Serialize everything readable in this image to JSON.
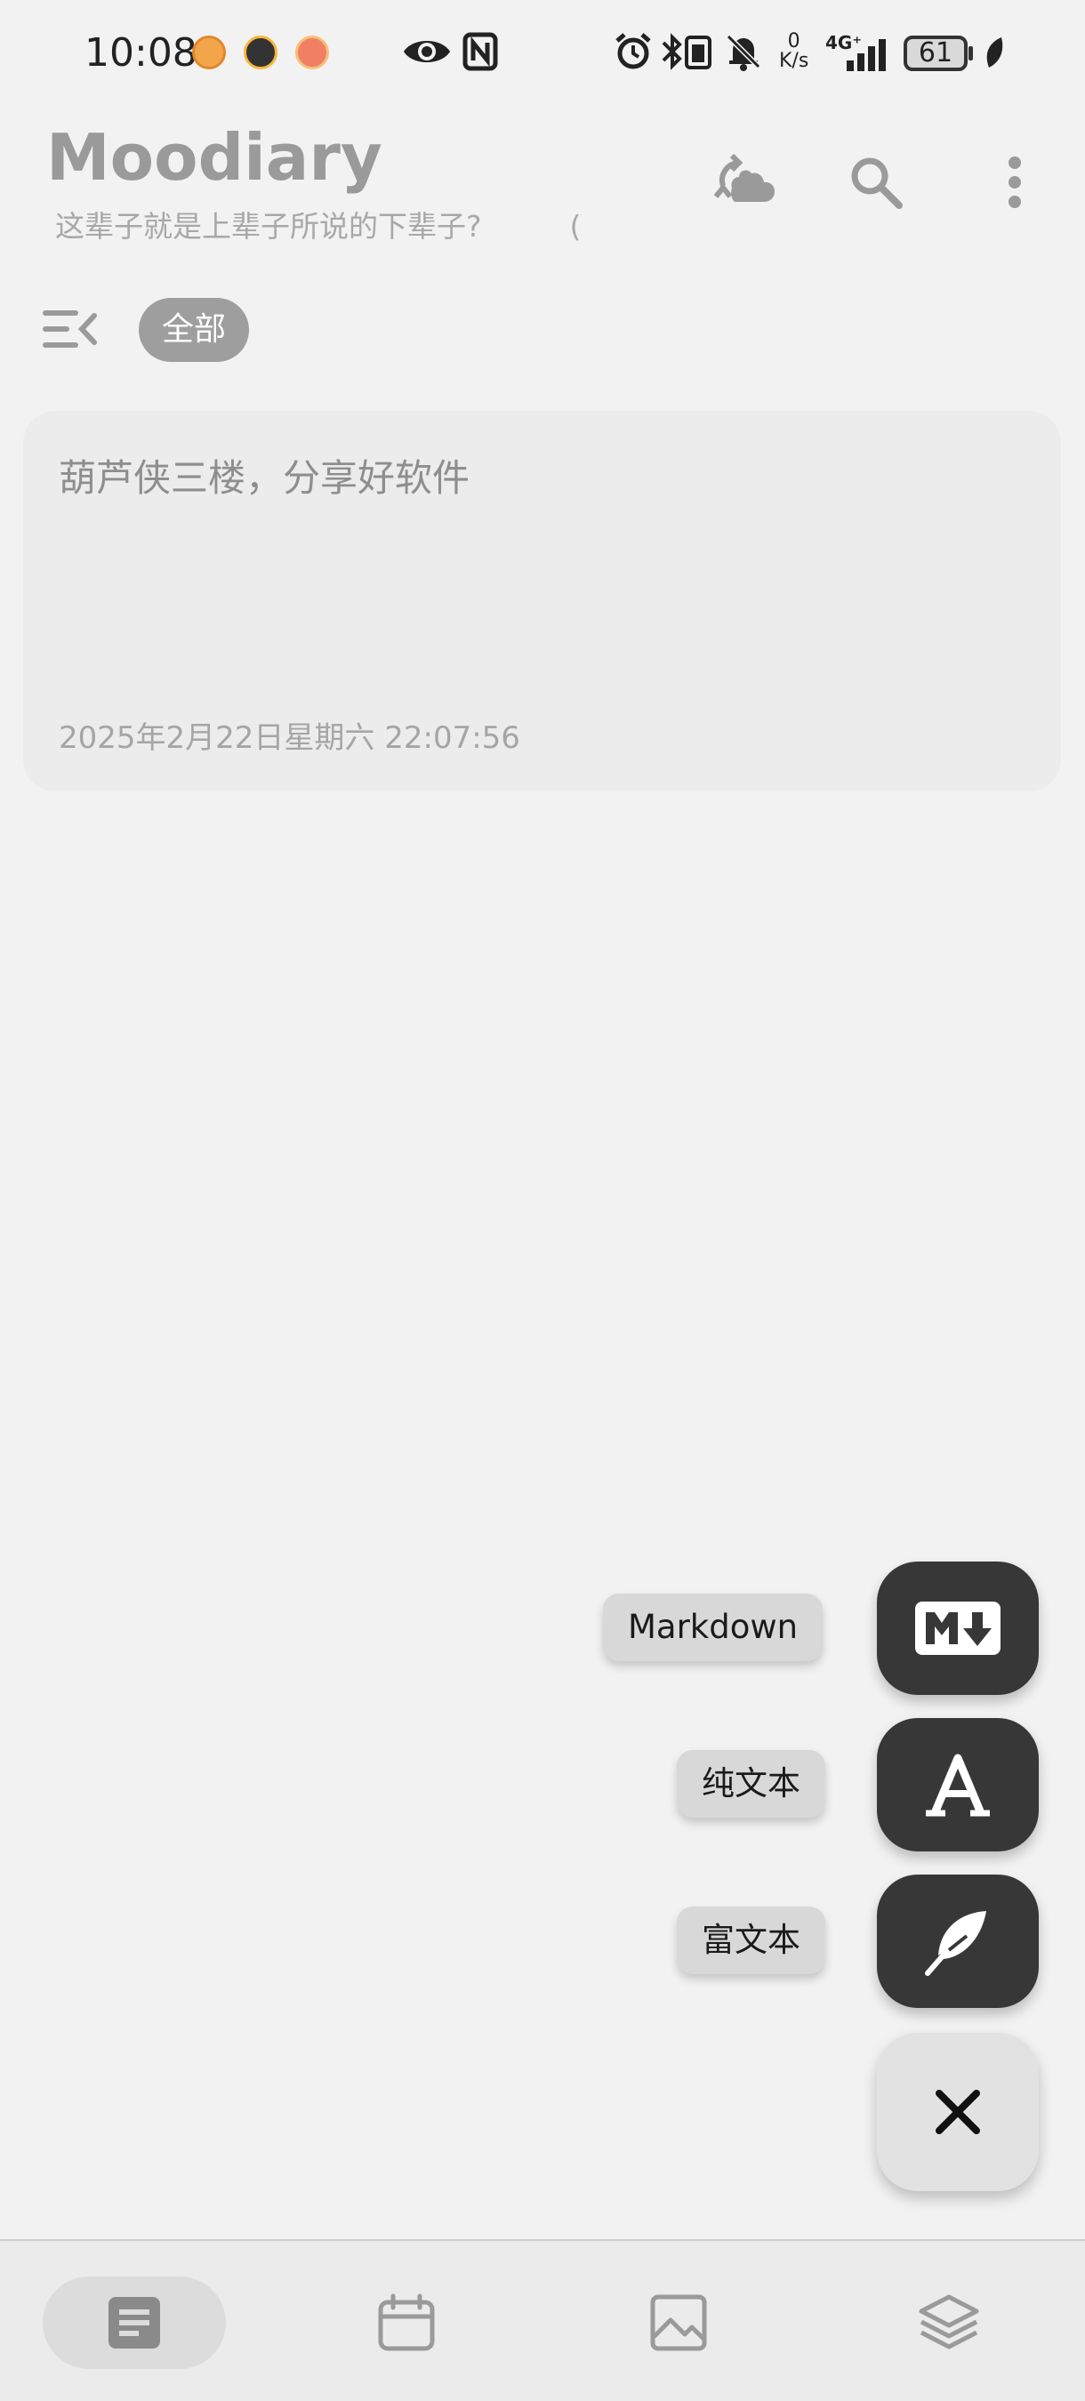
{
  "status_bar": {
    "time": "10:08",
    "network_speed_value": "0",
    "network_speed_unit": "K/s",
    "network_type": "4G⁺",
    "battery_level": "61"
  },
  "app_bar": {
    "title": "Moodiary",
    "subtitle": "这辈子就是上辈子所说的下辈子?　　　(",
    "icons": [
      "cloud-sync-icon",
      "search-icon",
      "more-vert-icon"
    ]
  },
  "filter": {
    "menu_icon": "menu-collapse-icon",
    "active_chip": "全部"
  },
  "diary_list": [
    {
      "content": "葫芦侠三楼，分享好软件",
      "date": "2025年2月22日星期六 22:07:56"
    }
  ],
  "fab_menu": {
    "items": [
      {
        "label": "Markdown",
        "icon": "markdown-icon"
      },
      {
        "label": "纯文本",
        "icon": "text-a-icon"
      },
      {
        "label": "富文本",
        "icon": "feather-icon"
      }
    ],
    "close_icon": "close-icon"
  },
  "bottom_nav": {
    "items": [
      {
        "name": "diary",
        "icon": "article-icon",
        "active": true
      },
      {
        "name": "calendar",
        "icon": "calendar-icon",
        "active": false
      },
      {
        "name": "gallery",
        "icon": "image-icon",
        "active": false
      },
      {
        "name": "more",
        "icon": "layers-icon",
        "active": false
      }
    ]
  },
  "colors": {
    "background": "#f2f2f2",
    "fab": "#373737",
    "chip": "#9e9e9e",
    "card": "#ececec"
  }
}
